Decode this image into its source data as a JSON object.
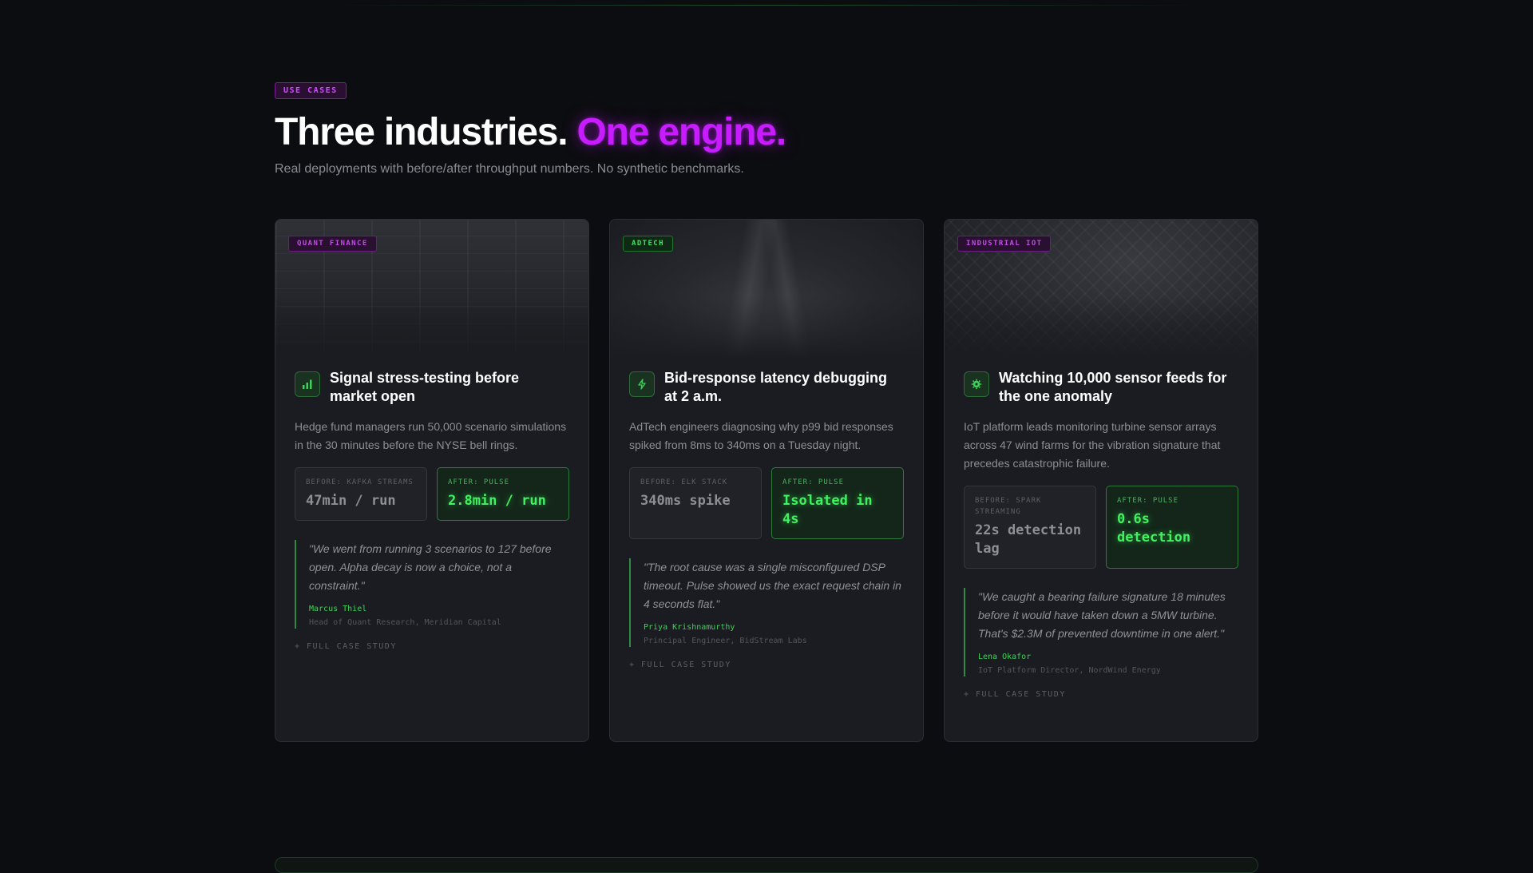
{
  "header": {
    "eyebrow": "USE CASES",
    "title_main": "Three industries.",
    "title_accent": "One engine.",
    "subtitle": "Real deployments with before/after throughput numbers. No synthetic benchmarks."
  },
  "colors": {
    "accent_purple": "#c61cff",
    "accent_green": "#3ff35f",
    "background": "#0c0d10",
    "card_background": "#1a1c21"
  },
  "cards": [
    {
      "tag": "QUANT FINANCE",
      "icon": "bar-chart-icon",
      "title": "Signal stress-testing before market open",
      "description": "Hedge fund managers run 50,000 scenario simulations in the 30 minutes before the NYSE bell rings.",
      "before_label": "BEFORE: KAFKA STREAMS",
      "before_value": "47min / run",
      "after_label": "AFTER: PULSE",
      "after_value": "2.8min / run",
      "quote": "\"We went from running 3 scenarios to 127 before open. Alpha decay is now a choice, not a constraint.\"",
      "author": "Marcus Thiel",
      "role": "Head of Quant Research, Meridian Capital",
      "link": "+ FULL CASE STUDY"
    },
    {
      "tag": "ADTECH",
      "icon": "lightning-icon",
      "title": "Bid-response latency debugging at 2 a.m.",
      "description": "AdTech engineers diagnosing why p99 bid responses spiked from 8ms to 340ms on a Tuesday night.",
      "before_label": "BEFORE: ELK STACK",
      "before_value": "340ms spike",
      "after_label": "AFTER: PULSE",
      "after_value": "Isolated in 4s",
      "quote": "\"The root cause was a single misconfigured DSP timeout. Pulse showed us the exact request chain in 4 seconds flat.\"",
      "author": "Priya Krishnamurthy",
      "role": "Principal Engineer, BidStream Labs",
      "link": "+ FULL CASE STUDY"
    },
    {
      "tag": "INDUSTRIAL IOT",
      "icon": "gear-icon",
      "title": "Watching 10,000 sensor feeds for the one anomaly",
      "description": "IoT platform leads monitoring turbine sensor arrays across 47 wind farms for the vibration signature that precedes catastrophic failure.",
      "before_label": "BEFORE: SPARK STREAMING",
      "before_value": "22s detection lag",
      "after_label": "AFTER: PULSE",
      "after_value": "0.6s detection",
      "quote": "\"We caught a bearing failure signature 18 minutes before it would have taken down a 5MW turbine. That's $2.3M of prevented downtime in one alert.\"",
      "author": "Lena Okafor",
      "role": "IoT Platform Director, NordWind Energy",
      "link": "+ FULL CASE STUDY"
    }
  ]
}
